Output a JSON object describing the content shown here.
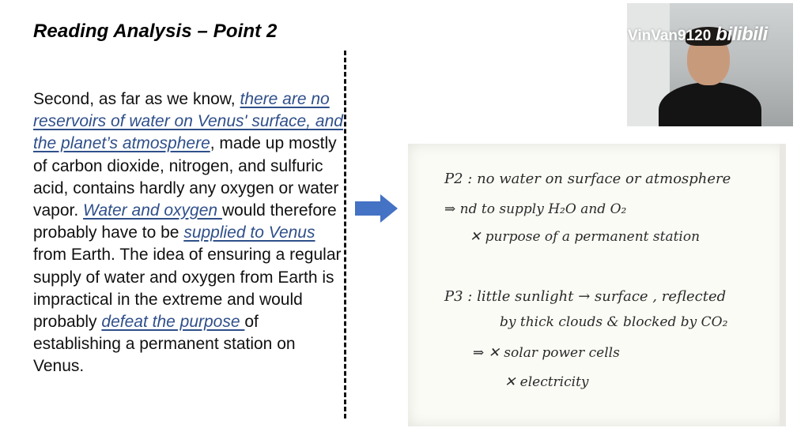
{
  "slide": {
    "title": "Reading Analysis – Point 2",
    "passage": [
      {
        "text": "Second, as far as we know, ",
        "highlight": false
      },
      {
        "text": "there are no reservoirs of water on Venus' surface, and the planet’s atmosphere",
        "highlight": true
      },
      {
        "text": ", made up mostly of carbon dioxide, nitrogen, and sulfuric acid, contains hardly any oxygen or water vapor. ",
        "highlight": false
      },
      {
        "text": "Water and oxygen ",
        "highlight": true
      },
      {
        "text": "would therefore probably have to be ",
        "highlight": false
      },
      {
        "text": "supplied to Venus ",
        "highlight": true
      },
      {
        "text": "from Earth. The idea of ensuring a regular supply of water and oxygen from Earth is impractical in the extreme and would probably ",
        "highlight": false
      },
      {
        "text": "defeat the purpose ",
        "highlight": true
      },
      {
        "text": "of establishing a permanent station on Venus.",
        "highlight": false
      }
    ]
  },
  "notes": {
    "lines": [
      "P2 : no water on surface or atmosphere",
      "⇒ nd to supply H₂O and O₂",
      "✕ purpose of a permanent station",
      "P3 : little sunlight → surface , reflected",
      "by thick clouds & blocked by CO₂",
      "⇒ ✕ solar power cells",
      "✕ electricity"
    ]
  },
  "watermark": {
    "user": "VinVan9120",
    "logo": "bilibili"
  },
  "colors": {
    "highlight": "#2f4f8a",
    "arrow": "#4472c4",
    "ink": "#2a2a2a"
  }
}
